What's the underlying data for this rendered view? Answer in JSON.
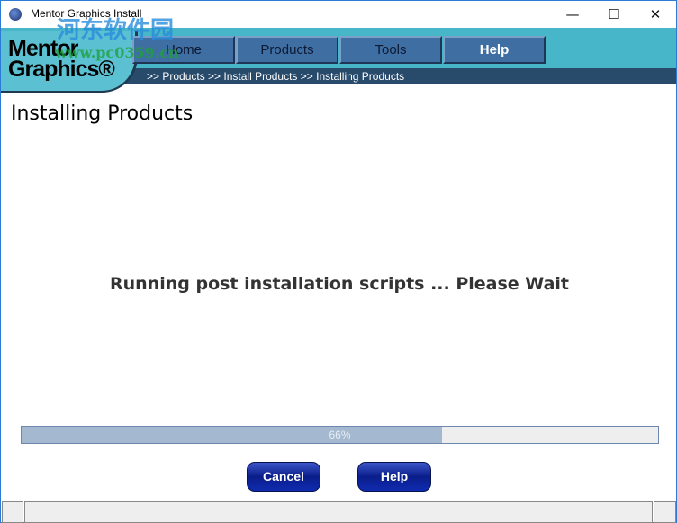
{
  "window": {
    "title": "Mentor Graphics Install",
    "minimize": "—",
    "maximize": "☐",
    "close": "✕"
  },
  "logo": {
    "line1": "Mentor",
    "line2": "Graphics®"
  },
  "nav": [
    {
      "label": "Home"
    },
    {
      "label": "Products"
    },
    {
      "label": "Tools"
    },
    {
      "label": "Help"
    }
  ],
  "breadcrumb": ">> Products >> Install Products >> Installing Products",
  "page": {
    "heading": "Installing Products",
    "message": "Running post installation scripts ... Please Wait"
  },
  "progress": {
    "percent": 66,
    "label": "66%"
  },
  "buttons": {
    "cancel": "Cancel",
    "help": "Help"
  },
  "watermark": {
    "name": "河东软件园",
    "url": "www.pc0359.cn"
  },
  "colors": {
    "header": "#48b6c9",
    "crumbbar": "#284a6b",
    "nav": "#3f6ea3",
    "progress_fill": "#a4b8cf"
  }
}
